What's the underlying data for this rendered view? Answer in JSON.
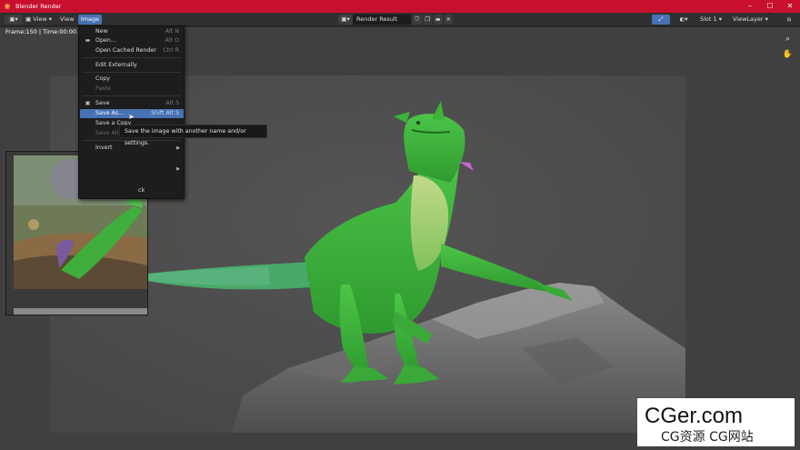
{
  "window": {
    "title": "Blender Render",
    "controls": [
      "–",
      "☐",
      "✕"
    ]
  },
  "header": {
    "editor_type_icon": "image-editor-icon",
    "view_label": "View",
    "menus": [
      "View",
      "Image"
    ],
    "image_name": "Render Result",
    "slot": "Slot 1",
    "view_layer": "ViewLayer"
  },
  "viewport": {
    "frame_info": "Frame:150 | Time:00:00.92"
  },
  "image_menu": {
    "items": [
      {
        "label": "New",
        "shortcut": "Alt N",
        "icon": "new-icon"
      },
      {
        "label": "Open...",
        "shortcut": "Alt O",
        "icon": "folder-icon"
      },
      {
        "label": "Open Cached Render",
        "shortcut": "Ctrl R"
      },
      {
        "label": "Edit Externally",
        "shortcut": ""
      },
      {
        "label": "Copy",
        "shortcut": ""
      },
      {
        "label": "Paste",
        "shortcut": ""
      },
      {
        "label": "Save",
        "shortcut": "Alt S",
        "icon": "save-icon"
      },
      {
        "label": "Save As...",
        "shortcut": "Shift Alt S"
      },
      {
        "label": "Save a Copy",
        "shortcut": ""
      },
      {
        "label": "Save All I",
        "shortcut": ""
      },
      {
        "label": "Invert",
        "shortcut": ""
      },
      {
        "label": "",
        "shortcut": ""
      },
      {
        "label": "ck",
        "shortcut": ""
      }
    ]
  },
  "tooltip": {
    "text": "Save the image with another name and/or settings."
  },
  "watermark": {
    "brand": "CGer.com",
    "subtitle": "CG资源 CG网站"
  },
  "colors": {
    "titlebar": "#c8102e",
    "accent": "#4772b3",
    "menu_bg": "#1d1d1d",
    "viewport_bg": "#404040",
    "creature": "#3fb33a"
  }
}
